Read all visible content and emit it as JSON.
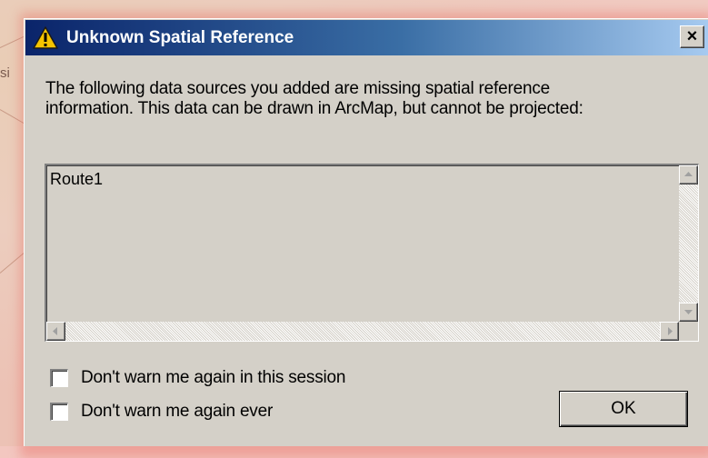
{
  "background": {
    "map_label_fragment": "si"
  },
  "dialog": {
    "title": "Unknown Spatial Reference",
    "title_icon": "warning-icon",
    "close_label": "×",
    "message_line1": "The following data sources you added are missing spatial reference",
    "message_line2": "information. This data can be drawn in ArcMap, but cannot be projected:",
    "list_items": [
      "Route1"
    ],
    "checkbox_session": {
      "label": "Don't warn me again in this session",
      "checked": false
    },
    "checkbox_ever": {
      "label": "Don't warn me again ever",
      "checked": false
    },
    "ok_label": "OK"
  },
  "colors": {
    "titlebar_start": "#0a246a",
    "titlebar_end": "#a6caf0",
    "dialog_face": "#d4d0c8",
    "warning_yellow": "#f5c400"
  }
}
